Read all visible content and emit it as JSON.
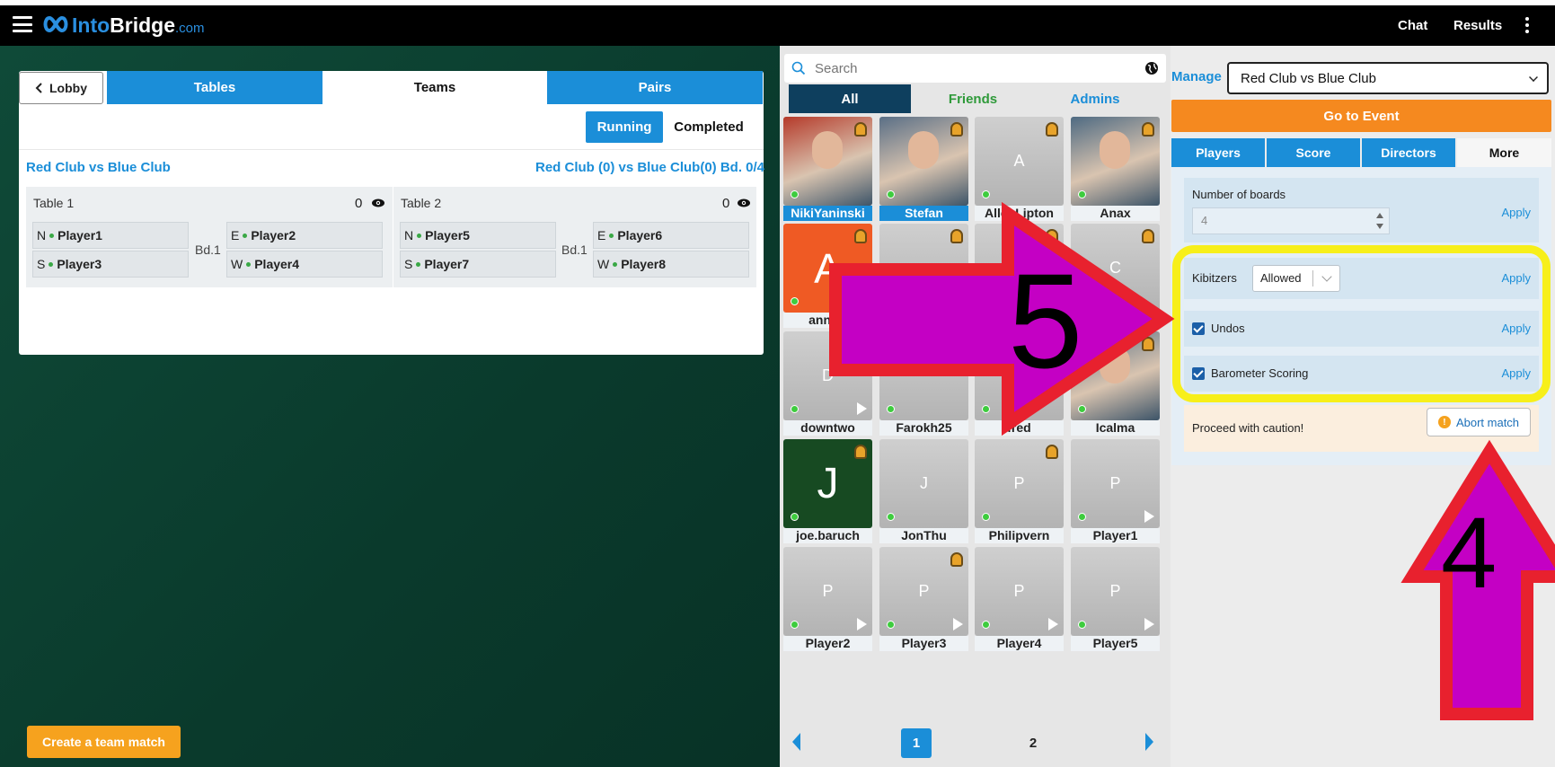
{
  "topbar": {
    "logo_into": "Into",
    "logo_bridge": "Bridge",
    "logo_com": ".com",
    "chat": "Chat",
    "results": "Results"
  },
  "left": {
    "lobby": "Lobby",
    "tabs": [
      "Tables",
      "Teams",
      "Pairs"
    ],
    "active_tab": "Teams",
    "running": "Running",
    "completed": "Completed",
    "match_title": "Red Club vs Blue Club",
    "match_status": "Red Club (0) vs Blue Club(0)  Bd. 0/4",
    "tables": [
      {
        "title": "Table 1",
        "score": "0",
        "board": "Bd.1",
        "n": {
          "dir": "N",
          "name": "Player1"
        },
        "s": {
          "dir": "S",
          "name": "Player3"
        },
        "e": {
          "dir": "E",
          "name": "Player2"
        },
        "w": {
          "dir": "W",
          "name": "Player4"
        }
      },
      {
        "title": "Table 2",
        "score": "0",
        "board": "Bd.1",
        "n": {
          "dir": "N",
          "name": "Player5"
        },
        "s": {
          "dir": "S",
          "name": "Player7"
        },
        "e": {
          "dir": "E",
          "name": "Player6"
        },
        "w": {
          "dir": "W",
          "name": "Player8"
        }
      }
    ],
    "create_team_match": "Create a team match"
  },
  "players": {
    "search_placeholder": "Search",
    "filter_tabs": [
      "All",
      "Friends",
      "Admins"
    ],
    "tiles": [
      {
        "name": "NikiYaninski",
        "initial": "",
        "photo": true,
        "badge": true,
        "online": true,
        "play": false,
        "selected": true
      },
      {
        "name": "Stefan",
        "initial": "",
        "photo": true,
        "badge": true,
        "online": true,
        "play": false,
        "selected": true
      },
      {
        "name": "AllenLipton",
        "initial": "A",
        "photo": false,
        "badge": true,
        "online": true,
        "play": false,
        "selected": false
      },
      {
        "name": "Anax",
        "initial": "",
        "photo": true,
        "badge": true,
        "online": true,
        "play": false,
        "selected": false
      },
      {
        "name": "ann.ro",
        "initial": "A",
        "photo": false,
        "badge": true,
        "online": true,
        "play": false,
        "selected": false
      },
      {
        "name": "",
        "initial": "",
        "photo": false,
        "badge": true,
        "online": false,
        "play": false,
        "selected": false
      },
      {
        "name": "",
        "initial": "",
        "photo": false,
        "badge": true,
        "online": false,
        "play": false,
        "selected": false
      },
      {
        "name": "",
        "initial": "C",
        "photo": false,
        "badge": true,
        "online": false,
        "play": false,
        "selected": false
      },
      {
        "name": "downtwo",
        "initial": "D",
        "photo": false,
        "badge": false,
        "online": true,
        "play": true,
        "selected": false
      },
      {
        "name": "Farokh25",
        "initial": "",
        "photo": false,
        "badge": false,
        "online": true,
        "play": false,
        "selected": false
      },
      {
        "name": "fred",
        "initial": "",
        "photo": false,
        "badge": false,
        "online": true,
        "play": false,
        "selected": false
      },
      {
        "name": "Icalma",
        "initial": "",
        "photo": true,
        "badge": true,
        "online": true,
        "play": false,
        "selected": false
      },
      {
        "name": "joe.baruch",
        "initial": "J",
        "photo": false,
        "badge": true,
        "online": true,
        "play": false,
        "selected": false
      },
      {
        "name": "JonThu",
        "initial": "J",
        "photo": false,
        "badge": false,
        "online": true,
        "play": false,
        "selected": false
      },
      {
        "name": "Philipvern",
        "initial": "P",
        "photo": false,
        "badge": true,
        "online": true,
        "play": false,
        "selected": false
      },
      {
        "name": "Player1",
        "initial": "P",
        "photo": false,
        "badge": false,
        "online": true,
        "play": true,
        "selected": false
      },
      {
        "name": "Player2",
        "initial": "P",
        "photo": false,
        "badge": false,
        "online": true,
        "play": true,
        "selected": false
      },
      {
        "name": "Player3",
        "initial": "P",
        "photo": false,
        "badge": true,
        "online": true,
        "play": true,
        "selected": false
      },
      {
        "name": "Player4",
        "initial": "P",
        "photo": false,
        "badge": false,
        "online": true,
        "play": true,
        "selected": false
      },
      {
        "name": "Player5",
        "initial": "P",
        "photo": false,
        "badge": false,
        "online": true,
        "play": true,
        "selected": false
      }
    ],
    "pages": [
      "1",
      "2"
    ],
    "current_page": "1"
  },
  "manage": {
    "label": "Manage",
    "selected_event": "Red Club vs Blue Club",
    "go_to_event": "Go to Event",
    "tabs": [
      "Players",
      "Score",
      "Directors",
      "More"
    ],
    "active_tab": "More",
    "number_of_boards_label": "Number of boards",
    "number_of_boards_value": "4",
    "apply": "Apply",
    "kibitzers_label": "Kibitzers",
    "kibitzers_value": "Allowed",
    "undos_label": "Undos",
    "undos_checked": true,
    "barometer_label": "Barometer Scoring",
    "barometer_checked": true,
    "caution": "Proceed with caution!",
    "abort": "Abort match"
  },
  "annotations": {
    "arrow_right_number": "5",
    "arrow_up_number": "4"
  },
  "colors": {
    "brand_blue": "#1b8ed8",
    "orange": "#f5891f",
    "green_bg": "#0a3a2c",
    "highlight_yellow": "#f7ef1a",
    "arrow_red": "#e8212e",
    "arrow_fill": "#c400c4"
  }
}
